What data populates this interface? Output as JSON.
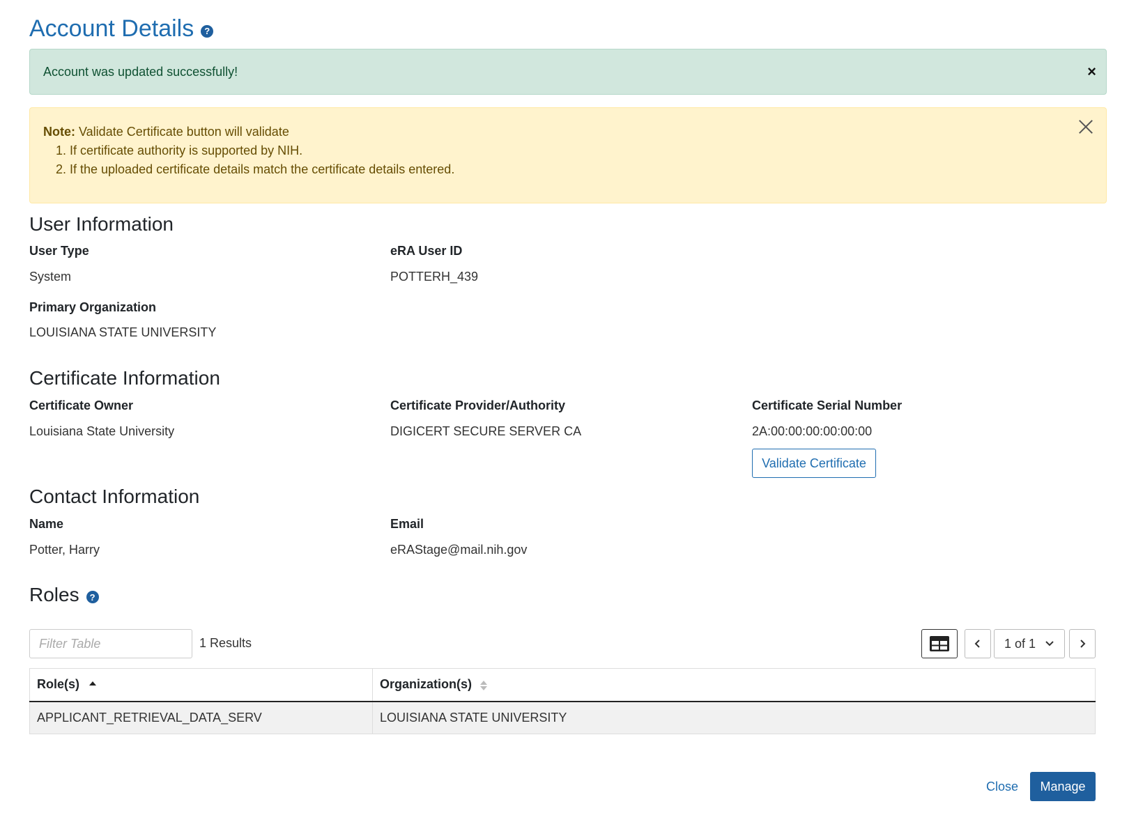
{
  "header": {
    "title": "Account Details",
    "help_glyph": "?"
  },
  "success_alert": {
    "message": "Account was updated successfully!",
    "close_glyph": "×"
  },
  "note_alert": {
    "label": "Note:",
    "text": " Validate Certificate button will validate",
    "items": [
      "If certificate authority is supported by NIH.",
      "If the uploaded certificate details match the certificate details entered."
    ]
  },
  "user_info": {
    "title": "User Information",
    "user_type_label": "User Type",
    "user_type_value": "System",
    "era_id_label": "eRA User ID",
    "era_id_value": "POTTERH_439",
    "org_label": "Primary Organization",
    "org_value": "LOUISIANA STATE UNIVERSITY"
  },
  "certificate_info": {
    "title": "Certificate Information",
    "owner_label": "Certificate Owner",
    "owner_value": "Louisiana State University",
    "provider_label": "Certificate Provider/Authority",
    "provider_value": "DIGICERT SECURE SERVER CA",
    "serial_label": "Certificate Serial Number",
    "serial_value": "2A:00:00:00:00:00:00",
    "validate_button": "Validate Certificate"
  },
  "contact_info": {
    "title": "Contact Information",
    "name_label": "Name",
    "name_value": "Potter, Harry",
    "email_label": "Email",
    "email_value": "eRAStage@mail.nih.gov"
  },
  "roles": {
    "title": "Roles",
    "help_glyph": "?",
    "filter_placeholder": "Filter Table",
    "results_text": "1 Results",
    "pager_text": "1 of 1",
    "columns": [
      "Role(s)",
      "Organization(s)"
    ],
    "rows": [
      [
        "APPLICANT_RETRIEVAL_DATA_SERV",
        "LOUISIANA STATE UNIVERSITY"
      ]
    ]
  },
  "footer": {
    "close_label": "Close",
    "manage_label": "Manage"
  },
  "icons": [
    "help-icon",
    "close-icon",
    "grid-view-icon",
    "chevron-left-icon",
    "chevron-down-icon",
    "chevron-right-icon",
    "sort-asc-icon",
    "sort-both-icon"
  ],
  "colors": {
    "primary": "#1f6db0",
    "success_bg": "#d1e7dd",
    "warning_bg": "#fff3cd"
  }
}
